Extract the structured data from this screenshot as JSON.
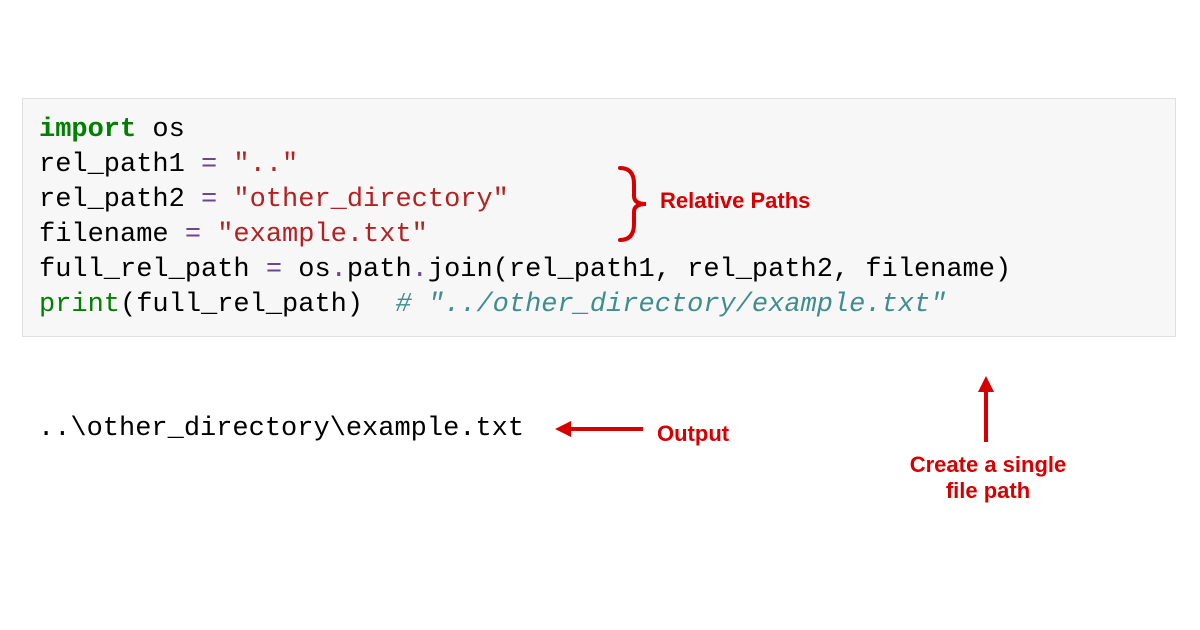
{
  "code": {
    "line1_import": "import",
    "line1_module": " os",
    "line2": "",
    "line3_var": "rel_path1 ",
    "line3_op": "=",
    "line3_str": " \"..\"",
    "line4_var": "rel_path2 ",
    "line4_op": "=",
    "line4_str": " \"other_directory\"",
    "line5_var": "filename ",
    "line5_op": "=",
    "line5_str": " \"example.txt\"",
    "line6_var": "full_rel_path ",
    "line6_op": "=",
    "line6_rest1": " os",
    "line6_rest2": ".",
    "line6_rest3": "path",
    "line6_rest4": ".",
    "line6_rest5": "join(rel_path1, rel_path2, filename)",
    "line7_builtin": "print",
    "line7_rest": "(full_rel_path)  ",
    "line7_comment": "# \"../other_directory/example.txt\""
  },
  "output": "..\\other_directory\\example.txt",
  "annotations": {
    "relative_paths": "Relative Paths",
    "output_label": "Output",
    "single_file": "Create a single file path"
  },
  "colors": {
    "annotation": "#d60000"
  }
}
